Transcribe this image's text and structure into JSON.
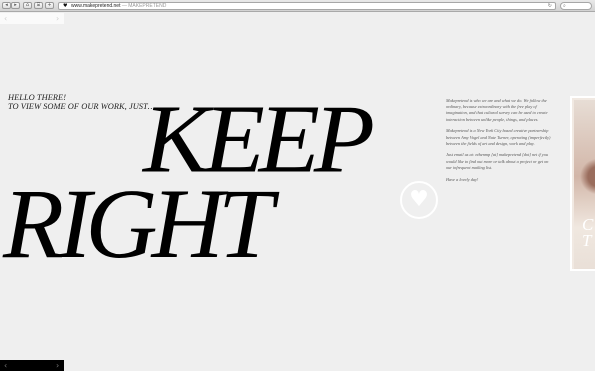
{
  "browser": {
    "back_icon": "left-arrow-icon",
    "forward_icon": "right-arrow-icon",
    "back_glyph": "◂",
    "forward_glyph": "▸",
    "home_glyph": "⌂",
    "bookmark_glyph": "⌸",
    "add_glyph": "+",
    "favicon_glyph": "♥",
    "url": "www.makepretend.net",
    "separator": "—",
    "page_title": "MAKEPRETEND",
    "reload_glyph": "↻",
    "search_glyph": "⌕"
  },
  "top_nav": {
    "prev_glyph": "‹",
    "next_glyph": "›"
  },
  "intro": {
    "hello": "HELLO THERE!",
    "cta": "TO VIEW SOME OF OUR WORK, JUST…",
    "keep": "KEEP",
    "right": "RIGHT"
  },
  "heart": {
    "glyph": "♥",
    "color": "#ffffff"
  },
  "about": {
    "p1": "Makepretend is who we are and what we do. We follow the ordinary, because extraordinary with the free play of imagination, and that cultural survey can be used to create interaction between unlike people, things, and places.",
    "p2": "Makepretend is a New York City based creative partnership between Amy Vogel and Nate Turner, operating (imperfectly) between the fields of art and design, work and play.",
    "p3": "Just email us at: nthenmp [at] makepretend [dot] net if you would like to find out more or talk about a project or get on our infrequent mailing list.",
    "p4": "Have a lovely day!"
  },
  "side_panel": {
    "letter1": "C",
    "letter2": "T"
  },
  "bottom_nav": {
    "prev_glyph": "‹",
    "next_glyph": "›"
  },
  "colors": {
    "background": "#efefef",
    "text": "#000000",
    "nav_bar": "#000000"
  }
}
